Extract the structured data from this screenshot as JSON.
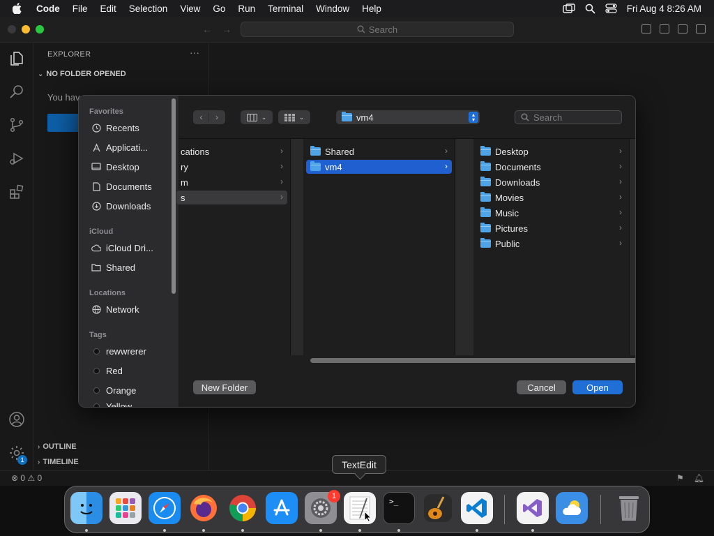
{
  "menubar": {
    "app_name": "Code",
    "items": [
      "File",
      "Edit",
      "Selection",
      "View",
      "Go",
      "Run",
      "Terminal",
      "Window",
      "Help"
    ],
    "datetime": "Fri Aug 4  8:26 AM"
  },
  "vscode": {
    "search_placeholder": "Search",
    "explorer_title": "EXPLORER",
    "explorer_more": "···",
    "no_folder": "NO FOLDER OPENED",
    "sidebar_text": "You hav",
    "outline": "OUTLINE",
    "timeline": "TIMELINE",
    "status_problems": "⊗ 0 ⚠ 0",
    "accounts_badge": "1"
  },
  "dialog": {
    "sidebar": {
      "favorites_header": "Favorites",
      "favorites": [
        "Recents",
        "Applicati...",
        "Desktop",
        "Documents",
        "Downloads"
      ],
      "icloud_header": "iCloud",
      "icloud": [
        "iCloud Dri...",
        "Shared"
      ],
      "locations_header": "Locations",
      "locations": [
        "Network"
      ],
      "tags_header": "Tags",
      "tags": [
        "rewwrerer",
        "Red",
        "Orange",
        "Yellow"
      ]
    },
    "path": "vm4",
    "search_placeholder": "Search",
    "column1": [
      "cations",
      "ry",
      "m",
      "s"
    ],
    "column2": [
      "Shared",
      "vm4"
    ],
    "column3": [
      "Desktop",
      "Documents",
      "Downloads",
      "Movies",
      "Music",
      "Pictures",
      "Public"
    ],
    "new_folder": "New Folder",
    "cancel": "Cancel",
    "open": "Open"
  },
  "dock": {
    "tooltip": "TextEdit",
    "settings_badge": "1",
    "terminal_prompt": ">_"
  }
}
